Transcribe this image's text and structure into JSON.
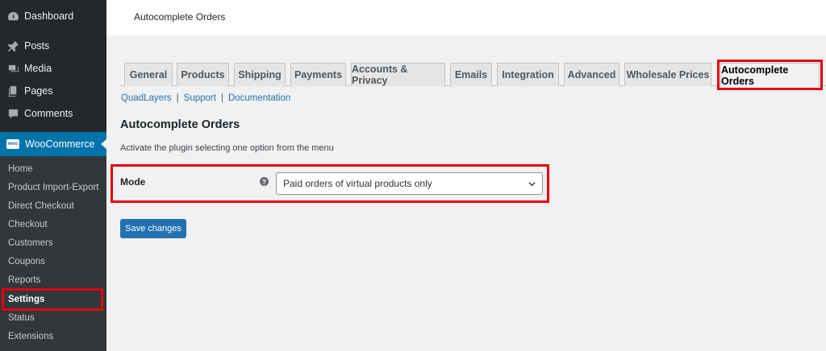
{
  "sidebar": {
    "top_items": [
      {
        "label": "Dashboard",
        "icon": "dashboard-icon"
      },
      {
        "label": "Posts",
        "icon": "pin-icon"
      },
      {
        "label": "Media",
        "icon": "media-icon"
      },
      {
        "label": "Pages",
        "icon": "pages-icon"
      },
      {
        "label": "Comments",
        "icon": "comment-icon"
      }
    ],
    "woocommerce": {
      "label": "WooCommerce",
      "icon_text": "woo"
    },
    "submenu": [
      "Home",
      "Product Import-Export",
      "Direct Checkout",
      "Checkout",
      "Customers",
      "Coupons",
      "Reports",
      "Settings",
      "Status",
      "Extensions"
    ],
    "active_submenu": "Settings"
  },
  "header": {
    "title": "Autocomplete Orders"
  },
  "tabs": [
    "General",
    "Products",
    "Shipping",
    "Payments",
    "Accounts & Privacy",
    "Emails",
    "Integration",
    "Advanced",
    "Wholesale Prices",
    "Autocomplete Orders"
  ],
  "active_tab": "Autocomplete Orders",
  "links": [
    "QuadLayers",
    "Support",
    "Documentation"
  ],
  "link_separator": "|",
  "section": {
    "title": "Autocomplete Orders",
    "description": "Activate the plugin selecting one option from the menu"
  },
  "mode": {
    "label": "Mode",
    "help_icon": "?",
    "selected": "Paid orders of virtual products only"
  },
  "save_button": "Save changes",
  "colors": {
    "accent": "#0073aa",
    "highlight": "#e1000f",
    "button": "#2271b1"
  }
}
